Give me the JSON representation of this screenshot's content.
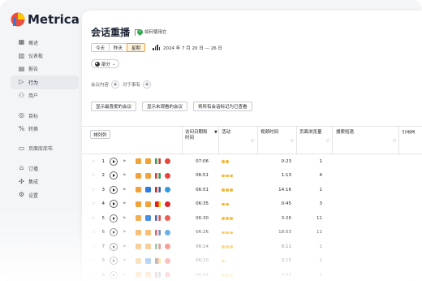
{
  "app": {
    "name": "Metrica"
  },
  "sidebar": {
    "items": [
      {
        "label": "概述",
        "icon": "grid-icon"
      },
      {
        "label": "仪表板",
        "icon": "dashboard-icon"
      },
      {
        "label": "报告",
        "icon": "report-icon"
      },
      {
        "label": "行为",
        "icon": "play-icon",
        "active": true
      },
      {
        "label": "用户",
        "icon": "user-icon"
      },
      {
        "label": "目标",
        "icon": "target-icon"
      },
      {
        "label": "转换",
        "icon": "percent-icon"
      },
      {
        "label": "页面库库布",
        "icon": "page-icon"
      },
      {
        "label": "订播",
        "icon": "home-icon"
      },
      {
        "label": "集成",
        "icon": "puzzle-icon"
      },
      {
        "label": "设置",
        "icon": "gear-icon"
      }
    ]
  },
  "header": {
    "title": "会话重播",
    "privacy_link": "如何使用它"
  },
  "dates": {
    "buttons": [
      "今天",
      "昨天",
      "星期"
    ],
    "selected": "星期",
    "range": "2024 年 7 月 20 日 — 26 日"
  },
  "segment": {
    "label": "部分"
  },
  "filters": {
    "conditions_label": "会议内容",
    "who_label": "对于事有"
  },
  "quick_buttons": [
    "显示最喜爱的会议",
    "显示未观看的会议",
    "将所有会话标记为已查看"
  ],
  "table": {
    "columns_button": "排列列",
    "headers": {
      "datetime": "访问日期和\n时间",
      "activity": "活动",
      "duration": "视频时间",
      "pageviews": "页面浏览量",
      "search": "搜索短语",
      "referrer": "引用网"
    },
    "rows": [
      {
        "num": "1",
        "time": "07:06",
        "activity": 2,
        "duration": "0:23",
        "pageviews": "1",
        "os": "apple",
        "browser": "chrome",
        "flag": "it"
      },
      {
        "num": "2",
        "time": "06:51",
        "activity": 3,
        "duration": "1:13",
        "pageviews": "4",
        "os": "android",
        "browser": "chrome",
        "flag": "hu"
      },
      {
        "num": "3",
        "time": "06:51",
        "activity": 3,
        "duration": "14:16",
        "pageviews": "1",
        "os": "windows",
        "browser": "edge",
        "flag": "us"
      },
      {
        "num": "4",
        "time": "06:35",
        "activity": 2,
        "duration": "0:45",
        "pageviews": "3",
        "os": "android",
        "browser": "opera",
        "flag": "cn"
      },
      {
        "num": "5",
        "time": "06:30",
        "activity": 3,
        "duration": "3:26",
        "pageviews": "11",
        "os": "windows",
        "browser": "chrome",
        "flag": "fr"
      },
      {
        "num": "6",
        "time": "06:26",
        "activity": 3,
        "duration": "18:03",
        "pageviews": "11",
        "os": "apple",
        "browser": "safari",
        "flag": "us"
      },
      {
        "num": "7",
        "time": "06:14",
        "activity": 3,
        "duration": "0:11",
        "pageviews": "1",
        "os": "apple",
        "browser": "chrome",
        "flag": "it"
      },
      {
        "num": "8",
        "time": "06:10",
        "activity": 1,
        "duration": "0:15",
        "pageviews": "1",
        "os": "windows",
        "browser": "chrome",
        "flag": "de"
      },
      {
        "num": "9",
        "time": "06:04",
        "activity": 3,
        "duration": "0:33",
        "pageviews": "1",
        "os": "android",
        "browser": "chrome",
        "flag": "us"
      }
    ]
  },
  "colors": {
    "accent": "#e7a23b",
    "brand_blue": "#3a7bd5",
    "star": "#f4b73a"
  }
}
